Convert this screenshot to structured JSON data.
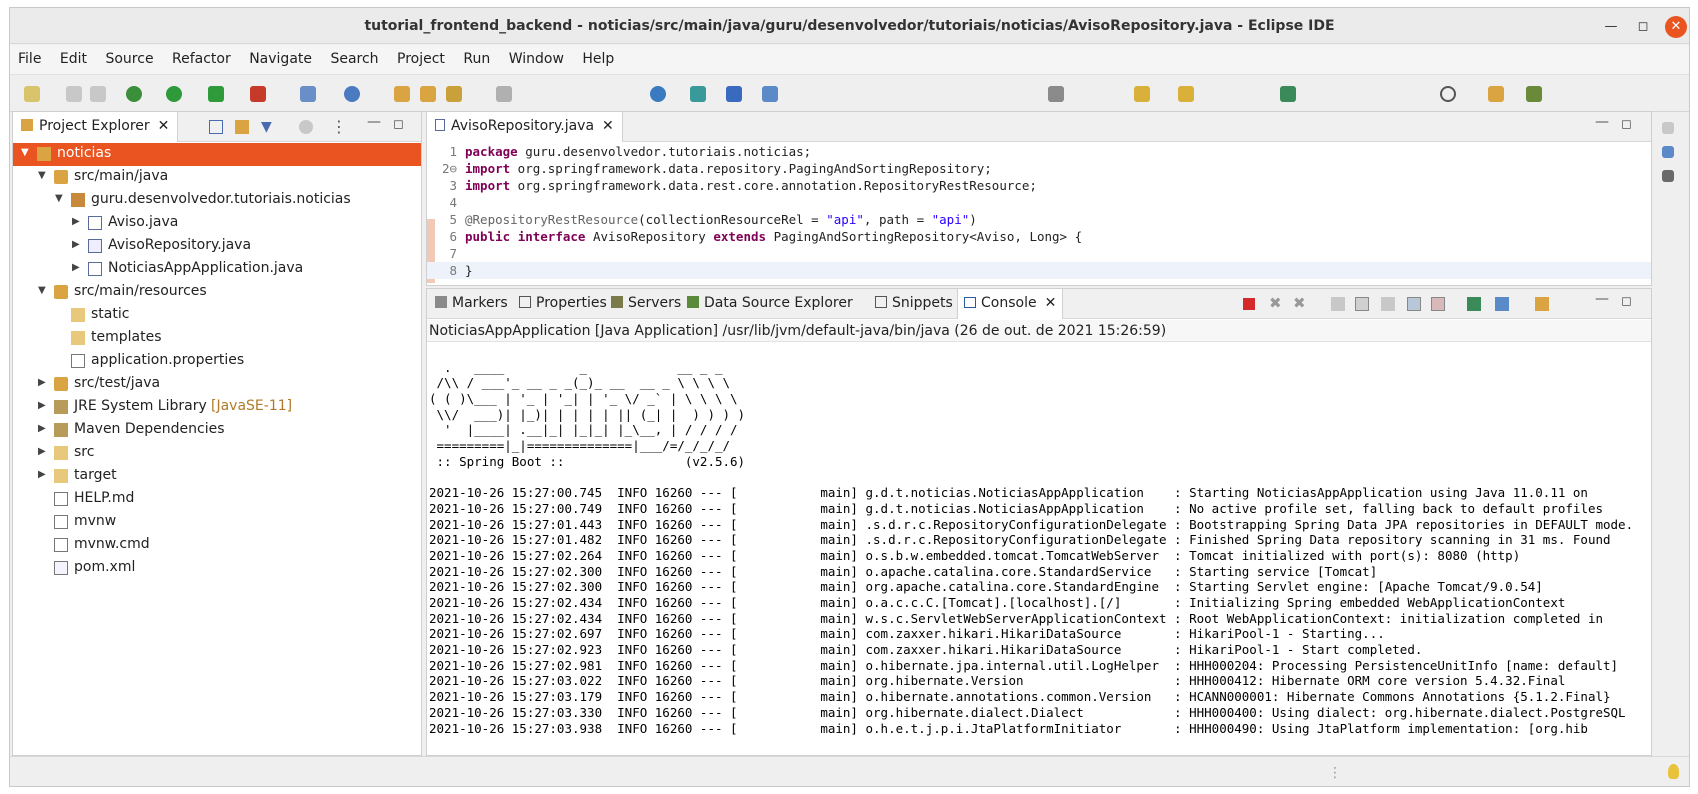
{
  "window": {
    "title": "tutorial_frontend_backend - noticias/src/main/java/guru/desenvolvedor/tutoriais/noticias/AvisoRepository.java - Eclipse IDE"
  },
  "menu": [
    "File",
    "Edit",
    "Source",
    "Refactor",
    "Navigate",
    "Search",
    "Project",
    "Run",
    "Window",
    "Help"
  ],
  "project_explorer": {
    "tab_label": "Project Explorer",
    "items": [
      {
        "label": "noticias",
        "depth": 0,
        "arrow": "expanded",
        "icon": "project-icon",
        "selected": true
      },
      {
        "label": "src/main/java",
        "depth": 1,
        "arrow": "expanded",
        "icon": "source-folder-icon"
      },
      {
        "label": "guru.desenvolvedor.tutoriais.noticias",
        "depth": 2,
        "arrow": "expanded",
        "icon": "package-icon"
      },
      {
        "label": "Aviso.java",
        "depth": 3,
        "arrow": "collapsed",
        "icon": "java-file-icon"
      },
      {
        "label": "AvisoRepository.java",
        "depth": 3,
        "arrow": "collapsed",
        "icon": "java-interface-icon"
      },
      {
        "label": "NoticiasAppApplication.java",
        "depth": 3,
        "arrow": "collapsed",
        "icon": "java-file-icon"
      },
      {
        "label": "src/main/resources",
        "depth": 1,
        "arrow": "expanded",
        "icon": "source-folder-icon"
      },
      {
        "label": "static",
        "depth": 2,
        "arrow": "none",
        "icon": "folder-icon"
      },
      {
        "label": "templates",
        "depth": 2,
        "arrow": "none",
        "icon": "folder-icon"
      },
      {
        "label": "application.properties",
        "depth": 2,
        "arrow": "none",
        "icon": "properties-file-icon"
      },
      {
        "label": "src/test/java",
        "depth": 1,
        "arrow": "collapsed",
        "icon": "source-folder-icon"
      },
      {
        "label": "JRE System Library",
        "decoration": "[JavaSE-11]",
        "depth": 1,
        "arrow": "collapsed",
        "icon": "library-icon"
      },
      {
        "label": "Maven Dependencies",
        "depth": 1,
        "arrow": "collapsed",
        "icon": "library-icon"
      },
      {
        "label": "src",
        "depth": 1,
        "arrow": "collapsed",
        "icon": "folder-icon"
      },
      {
        "label": "target",
        "depth": 1,
        "arrow": "collapsed",
        "icon": "folder-icon"
      },
      {
        "label": "HELP.md",
        "depth": 1,
        "arrow": "none",
        "icon": "markdown-file-icon"
      },
      {
        "label": "mvnw",
        "depth": 1,
        "arrow": "none",
        "icon": "file-icon"
      },
      {
        "label": "mvnw.cmd",
        "depth": 1,
        "arrow": "none",
        "icon": "file-icon"
      },
      {
        "label": "pom.xml",
        "depth": 1,
        "arrow": "none",
        "icon": "xml-file-icon"
      }
    ]
  },
  "editor": {
    "tab_label": "AvisoRepository.java",
    "lines": [
      {
        "n": "1",
        "t": [
          [
            "kw",
            "package"
          ],
          [
            "",
            " guru.desenvolvedor.tutoriais.noticias;"
          ]
        ]
      },
      {
        "n": "2⊖",
        "t": [
          [
            "kw",
            "import"
          ],
          [
            "",
            " org.springframework.data.repository.PagingAndSortingRepository;"
          ]
        ]
      },
      {
        "n": "3",
        "t": [
          [
            "kw",
            "import"
          ],
          [
            "",
            " org.springframework.data.rest.core.annotation.RepositoryRestResource;"
          ]
        ]
      },
      {
        "n": "4",
        "t": []
      },
      {
        "n": "5",
        "t": [
          [
            "ann",
            "@RepositoryRestResource"
          ],
          [
            "",
            "(collectionResourceRel = "
          ],
          [
            "str",
            "\"api\""
          ],
          [
            "",
            ", path = "
          ],
          [
            "str",
            "\"api\""
          ],
          [
            "",
            ")"
          ]
        ]
      },
      {
        "n": "6",
        "t": [
          [
            "kw",
            "public"
          ],
          [
            "",
            " "
          ],
          [
            "kw",
            "interface"
          ],
          [
            "",
            " AvisoRepository "
          ],
          [
            "kw",
            "extends"
          ],
          [
            "",
            " PagingAndSortingRepository<Aviso, Long> {"
          ]
        ]
      },
      {
        "n": "7",
        "t": []
      },
      {
        "n": "8",
        "t": [
          [
            "",
            "}"
          ]
        ]
      }
    ]
  },
  "bottom_tabs": [
    "Markers",
    "Properties",
    "Servers",
    "Data Source Explorer",
    "Snippets",
    "Console"
  ],
  "console": {
    "description": "NoticiasAppApplication [Java Application] /usr/lib/jvm/default-java/bin/java  (26 de out. de 2021 15:26:59)",
    "lines": [
      "",
      "  .   ____          _            __ _ _",
      " /\\\\ / ___'_ __ _ _(_)_ __  __ _ \\ \\ \\ \\",
      "( ( )\\___ | '_ | '_| | '_ \\/ _` | \\ \\ \\ \\",
      " \\\\/  ___)| |_)| | | | | || (_| |  ) ) ) )",
      "  '  |____| .__|_| |_|_| |_\\__, | / / / /",
      " =========|_|==============|___/=/_/_/_/",
      " :: Spring Boot ::                (v2.5.6)",
      "",
      "2021-10-26 15:27:00.745  INFO 16260 --- [           main] g.d.t.noticias.NoticiasAppApplication    : Starting NoticiasAppApplication using Java 11.0.11 on",
      "2021-10-26 15:27:00.749  INFO 16260 --- [           main] g.d.t.noticias.NoticiasAppApplication    : No active profile set, falling back to default profiles",
      "2021-10-26 15:27:01.443  INFO 16260 --- [           main] .s.d.r.c.RepositoryConfigurationDelegate : Bootstrapping Spring Data JPA repositories in DEFAULT mode.",
      "2021-10-26 15:27:01.482  INFO 16260 --- [           main] .s.d.r.c.RepositoryConfigurationDelegate : Finished Spring Data repository scanning in 31 ms. Found",
      "2021-10-26 15:27:02.264  INFO 16260 --- [           main] o.s.b.w.embedded.tomcat.TomcatWebServer  : Tomcat initialized with port(s): 8080 (http)",
      "2021-10-26 15:27:02.300  INFO 16260 --- [           main] o.apache.catalina.core.StandardService   : Starting service [Tomcat]",
      "2021-10-26 15:27:02.300  INFO 16260 --- [           main] org.apache.catalina.core.StandardEngine  : Starting Servlet engine: [Apache Tomcat/9.0.54]",
      "2021-10-26 15:27:02.434  INFO 16260 --- [           main] o.a.c.c.C.[Tomcat].[localhost].[/]       : Initializing Spring embedded WebApplicationContext",
      "2021-10-26 15:27:02.434  INFO 16260 --- [           main] w.s.c.ServletWebServerApplicationContext : Root WebApplicationContext: initialization completed in",
      "2021-10-26 15:27:02.697  INFO 16260 --- [           main] com.zaxxer.hikari.HikariDataSource       : HikariPool-1 - Starting...",
      "2021-10-26 15:27:02.923  INFO 16260 --- [           main] com.zaxxer.hikari.HikariDataSource       : HikariPool-1 - Start completed.",
      "2021-10-26 15:27:02.981  INFO 16260 --- [           main] o.hibernate.jpa.internal.util.LogHelper  : HHH000204: Processing PersistenceUnitInfo [name: default]",
      "2021-10-26 15:27:03.022  INFO 16260 --- [           main] org.hibernate.Version                    : HHH000412: Hibernate ORM core version 5.4.32.Final",
      "2021-10-26 15:27:03.179  INFO 16260 --- [           main] o.hibernate.annotations.common.Version   : HCANN000001: Hibernate Commons Annotations {5.1.2.Final}",
      "2021-10-26 15:27:03.330  INFO 16260 --- [           main] org.hibernate.dialect.Dialect            : HHH000400: Using dialect: org.hibernate.dialect.PostgreSQL",
      "2021-10-26 15:27:03.938  INFO 16260 --- [           main] o.h.e.t.j.p.i.JtaPlatformInitiator       : HHH000490: Using JtaPlatform implementation: [org.hib"
    ]
  },
  "colors": {
    "selection": "#e95420",
    "keyword": "#7f0055",
    "string": "#2a00ff",
    "annotation": "#646464"
  }
}
